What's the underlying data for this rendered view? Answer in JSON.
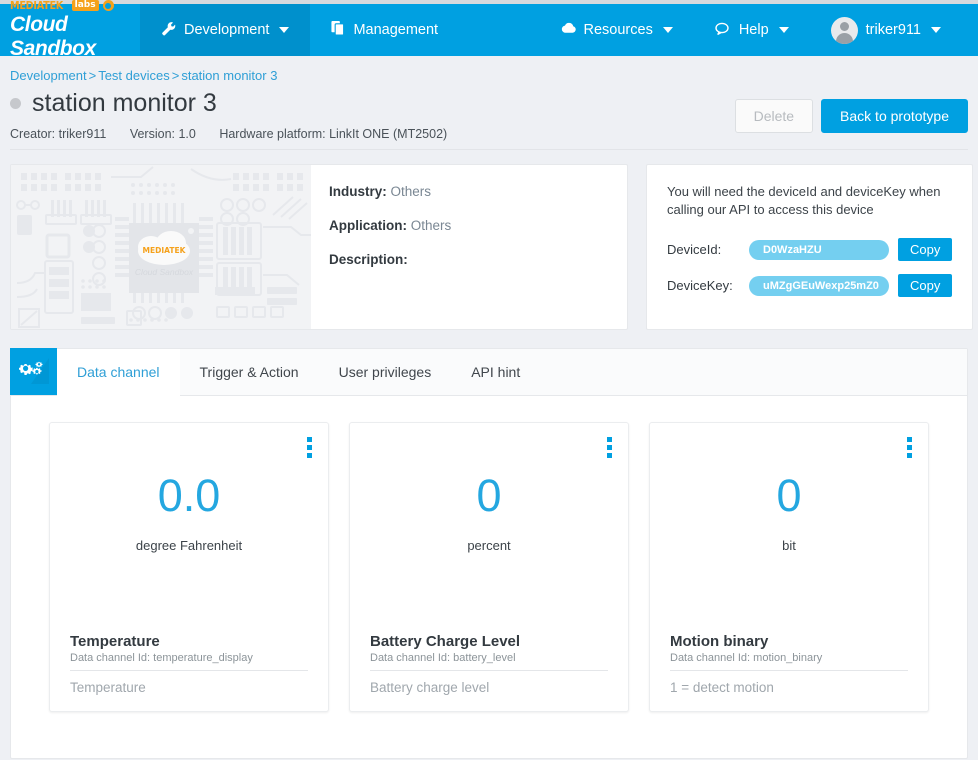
{
  "header": {
    "brand": {
      "mediatek": "MEDIATEK",
      "labs": "labs",
      "product": "Cloud Sandbox"
    },
    "nav": [
      {
        "label": "Development",
        "icon": "wrench-icon",
        "caret": true,
        "active": true
      },
      {
        "label": "Management",
        "icon": "copy-icon",
        "caret": false,
        "active": false
      }
    ],
    "nav_right": [
      {
        "label": "Resources",
        "icon": "cloud-icon",
        "caret": true
      },
      {
        "label": "Help",
        "icon": "chat-icon",
        "caret": true
      }
    ],
    "user": {
      "name": "triker911",
      "caret": true
    }
  },
  "breadcrumb": {
    "items": [
      "Development",
      "Test devices",
      "station monitor 3"
    ],
    "separator": ">"
  },
  "page": {
    "title": "station monitor 3",
    "status": "offline",
    "meta": [
      "Creator: triker911",
      "Version: 1.0",
      "Hardware platform: LinkIt ONE (MT2502)"
    ],
    "buttons": {
      "delete": "Delete",
      "back": "Back to prototype"
    }
  },
  "device_info": [
    {
      "label": "Industry",
      "value": "Others"
    },
    {
      "label": "Application",
      "value": "Others"
    },
    {
      "label": "Description",
      "value": ""
    }
  ],
  "device_image": {
    "alt": "circuit-board-placeholder",
    "logo_text": "MEDIATEK",
    "logo_sub": "Cloud Sandbox"
  },
  "api_panel": {
    "note": "You will need the deviceId and deviceKey when calling our API to access this device",
    "fields": [
      {
        "label": "DeviceId:",
        "value": "D0WzaHZU",
        "copy": "Copy"
      },
      {
        "label": "DeviceKey:",
        "value": "uMZgGEuWexp25mZ0",
        "copy": "Copy"
      }
    ]
  },
  "tabs": {
    "icon": "gears-icon",
    "items": [
      {
        "label": "Data channel",
        "active": true
      },
      {
        "label": "Trigger & Action",
        "active": false
      },
      {
        "label": "User privileges",
        "active": false
      },
      {
        "label": "API hint",
        "active": false
      }
    ]
  },
  "channels": [
    {
      "value": "0.0",
      "unit": "degree Fahrenheit",
      "name": "Temperature",
      "id_label": "Data channel Id: temperature_display",
      "description": "Temperature"
    },
    {
      "value": "0",
      "unit": "percent",
      "name": "Battery Charge Level",
      "id_label": "Data channel Id: battery_level",
      "description": "Battery charge level"
    },
    {
      "value": "0",
      "unit": "bit",
      "name": "Motion binary",
      "id_label": "Data channel Id: motion_binary",
      "description": "1 = detect motion"
    }
  ],
  "colors": {
    "brand_blue": "#00a0e1",
    "active_nav": "#0090cc",
    "link_blue": "#2f9fd6",
    "value_blue": "#24a7e0",
    "pill_blue": "#74cff0",
    "orange": "#f5a11b",
    "page_bg": "#eef0f4"
  }
}
